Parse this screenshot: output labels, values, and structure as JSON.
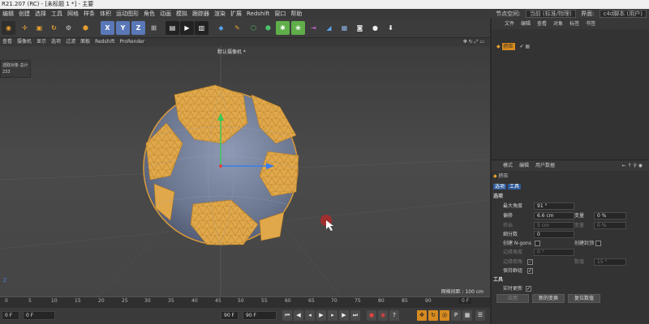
{
  "window": {
    "title": "R21.207 (RC) - [未标题 1 *] - 主要"
  },
  "menu": {
    "items": [
      "编辑",
      "创建",
      "选择",
      "工具",
      "网格",
      "样条",
      "体积",
      "运动图形",
      "角色",
      "动画",
      "模拟",
      "跟踪器",
      "渲染",
      "扩展",
      "Redshift",
      "窗口",
      "帮助"
    ],
    "node_space_label": "节点空间:",
    "node_space_value": "当前 (标准/物理)",
    "interface_label": "界面:",
    "interface_value": "c4d脚本 (用户)"
  },
  "toolbar": {
    "x_label": "X",
    "y_label": "Y",
    "z_label": "Z"
  },
  "view_menu": [
    "查看",
    "摄像机",
    "显示",
    "选项",
    "过滤",
    "面板",
    "Redshift",
    "ProRender"
  ],
  "viewport": {
    "camera_label": "默认摄像机 *",
    "grid_spacing": "网格间距 : 100 cm",
    "hud_title": "选取对象 总计",
    "hud_value": "233",
    "z_axis_label": "Z"
  },
  "timeline": {
    "ticks": [
      "0",
      "5",
      "10",
      "15",
      "20",
      "25",
      "30",
      "35",
      "40",
      "45",
      "50",
      "55",
      "60",
      "65",
      "70",
      "75",
      "80",
      "85",
      "90"
    ],
    "end_label": "0 F"
  },
  "playback": {
    "start_field": "0 F",
    "current_field": "0 F",
    "end_field": "90 F",
    "end_field2": "90 F"
  },
  "object_manager": {
    "tabs": [
      "文件",
      "编辑",
      "查看",
      "对象",
      "标签",
      "书签"
    ],
    "object_name": "挤压"
  },
  "attribute_manager": {
    "tabs": [
      "模式",
      "编辑",
      "用户数据"
    ],
    "object_title": "挤压",
    "subtabs": [
      "选项",
      "工具"
    ],
    "options_header": "选项",
    "max_angle_label": "最大角度",
    "max_angle_value": "91 °",
    "offset_label": "偏移",
    "offset_value": "6.6 cm",
    "variance_label": "变量",
    "variance_value": "0 %",
    "extrude_label": "挤出",
    "extrude_value": "5 cm",
    "variance2_label": "变量",
    "variance2_value": "0 %",
    "subdivision_label": "细分数",
    "subdivision_value": "0",
    "ngons_label": "创建 N-gons",
    "caps_label": "创建封顶",
    "edge_angle_label": "边缘角度",
    "edge_angle_value": "0 °",
    "edge_bevel_label": "边缘倒角",
    "count_label": "数值",
    "count_value": "15 °",
    "keep_groups_label": "保持群组",
    "tools_header": "工具",
    "realtime_label": "实时更新",
    "apply_button": "应用",
    "new_transform_button": "新的变换",
    "reset_button": "复位数值"
  }
}
